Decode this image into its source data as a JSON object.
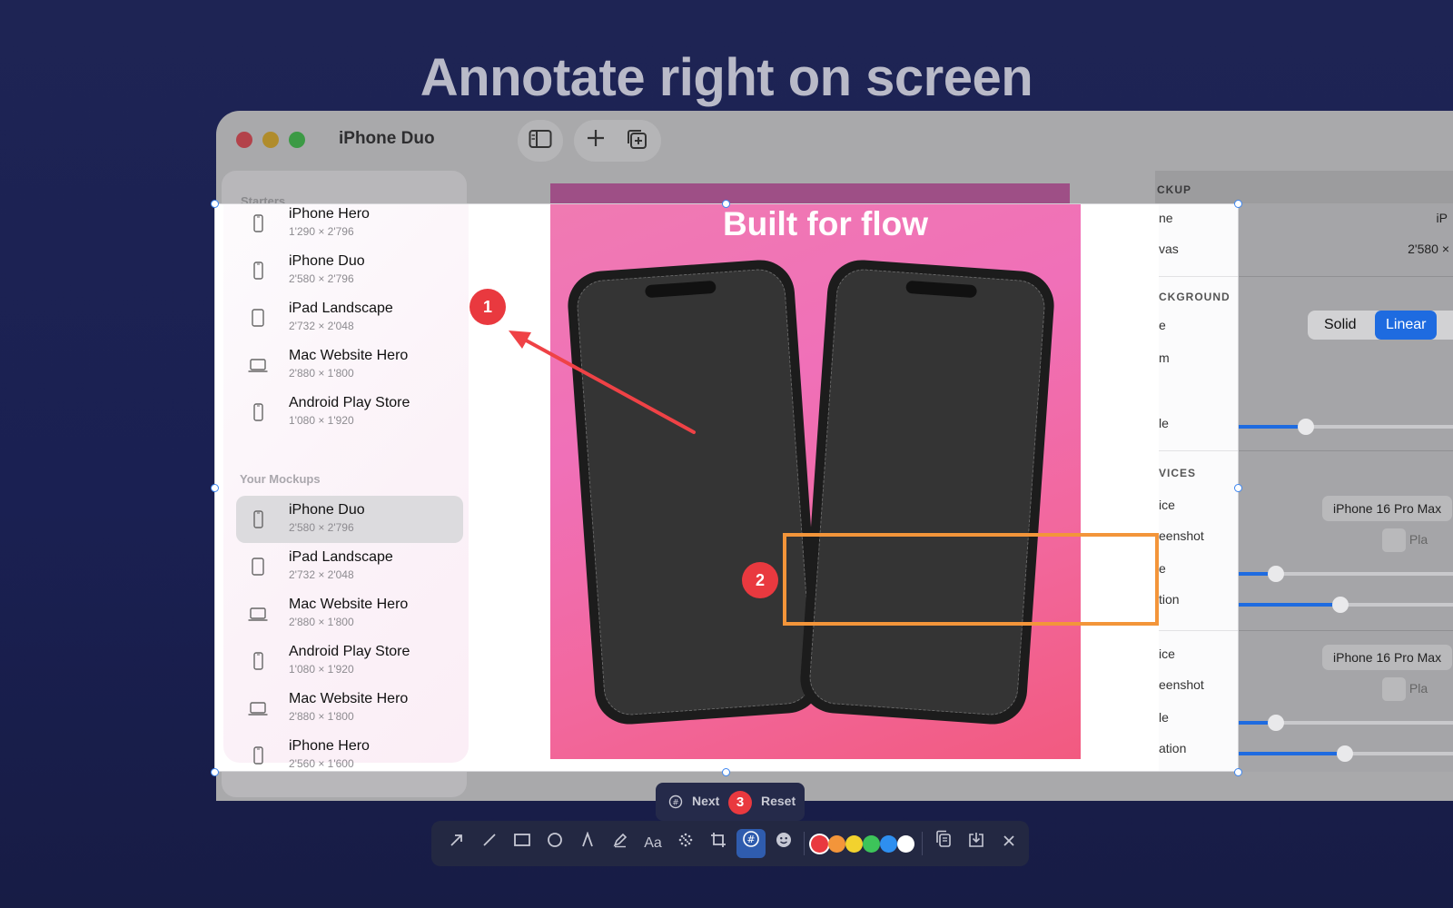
{
  "headline": "Annotate right on screen",
  "window": {
    "title": "iPhone Duo",
    "toolbar_icons": [
      "sidebar-toggle-icon",
      "plus-icon",
      "duplicate-icon"
    ]
  },
  "sidebar": {
    "starters_label": "Starters",
    "your_mockups_label": "Your Mockups",
    "starters": [
      {
        "name": "iPhone Hero",
        "size": "1'290 × 2'796",
        "icon": "phone-icon"
      },
      {
        "name": "iPhone Duo",
        "size": "2'580 × 2'796",
        "icon": "phone-icon"
      },
      {
        "name": "iPad Landscape",
        "size": "2'732 × 2'048",
        "icon": "tablet-icon"
      },
      {
        "name": "Mac Website Hero",
        "size": "2'880 × 1'800",
        "icon": "laptop-icon"
      },
      {
        "name": "Android Play Store",
        "size": "1'080 × 1'920",
        "icon": "phone-icon"
      }
    ],
    "mockups": [
      {
        "name": "iPhone Duo",
        "size": "2'580 × 2'796",
        "icon": "phone-icon",
        "selected": true
      },
      {
        "name": "iPad Landscape",
        "size": "2'732 × 2'048",
        "icon": "tablet-icon"
      },
      {
        "name": "Mac Website Hero",
        "size": "2'880 × 1'800",
        "icon": "laptop-icon"
      },
      {
        "name": "Android Play Store",
        "size": "1'080 × 1'920",
        "icon": "phone-icon"
      },
      {
        "name": "Mac Website Hero",
        "size": "2'880 × 1'800",
        "icon": "laptop-icon"
      },
      {
        "name": "iPhone Hero",
        "size": "2'560 × 1'600",
        "icon": "phone-icon"
      }
    ]
  },
  "preview": {
    "title": "Built for flow"
  },
  "inspector": {
    "mockup_head": "CKUP",
    "name_label": "ne",
    "name_value": "iP",
    "canvas_label": "vas",
    "canvas_value": "2'580 ×",
    "background_head": "CKGROUND",
    "type_label": "e",
    "seg_solid": "Solid",
    "seg_linear": "Linear",
    "from_label": "m",
    "angle_label": "le",
    "devices_head": "VICES",
    "device1_label": "ice",
    "device1_value": "iPhone 16 Pro Max",
    "screenshot1_label": "eenshot",
    "screenshot1_value": "Pla",
    "scale1_label": "e",
    "rotation1_label": "tion",
    "device2_label": "ice",
    "device2_value": "iPhone 16 Pro Max",
    "screenshot2_label": "eenshot",
    "screenshot2_value": "Pla",
    "scale2_label": "le",
    "rotation2_label": "ation"
  },
  "sliders": {
    "angle": 0.35,
    "scale1": 0.22,
    "rotation1": 0.5,
    "scale2": 0.22,
    "rotation2": 0.52
  },
  "annotations": {
    "marker1": "1",
    "marker2": "2"
  },
  "stepbar": {
    "next_label": "Next",
    "step_number": "3",
    "reset_label": "Reset"
  },
  "toolbar": {
    "tools": [
      "arrow-tool-icon",
      "line-tool-icon",
      "rectangle-tool-icon",
      "ellipse-tool-icon",
      "pen-tool-icon",
      "highlighter-tool-icon",
      "text-tool-icon",
      "blur-tool-icon",
      "crop-tool-icon",
      "counter-tool-icon",
      "emoji-tool-icon"
    ],
    "text_tool_label": "Aa",
    "active_tool": "counter-tool-icon",
    "colors": [
      "#e9393f",
      "#f3953a",
      "#f2d22e",
      "#3dc45a",
      "#2e8ff0",
      "#ffffff"
    ],
    "selected_color": "#e9393f",
    "actions": [
      "copy-icon",
      "save-icon",
      "close-icon"
    ]
  },
  "colors": {
    "accent": "#1e6be0",
    "annotation_red": "#e9393f",
    "annotation_orange": "#f3953a",
    "selection_handle": "#3d86f0"
  }
}
